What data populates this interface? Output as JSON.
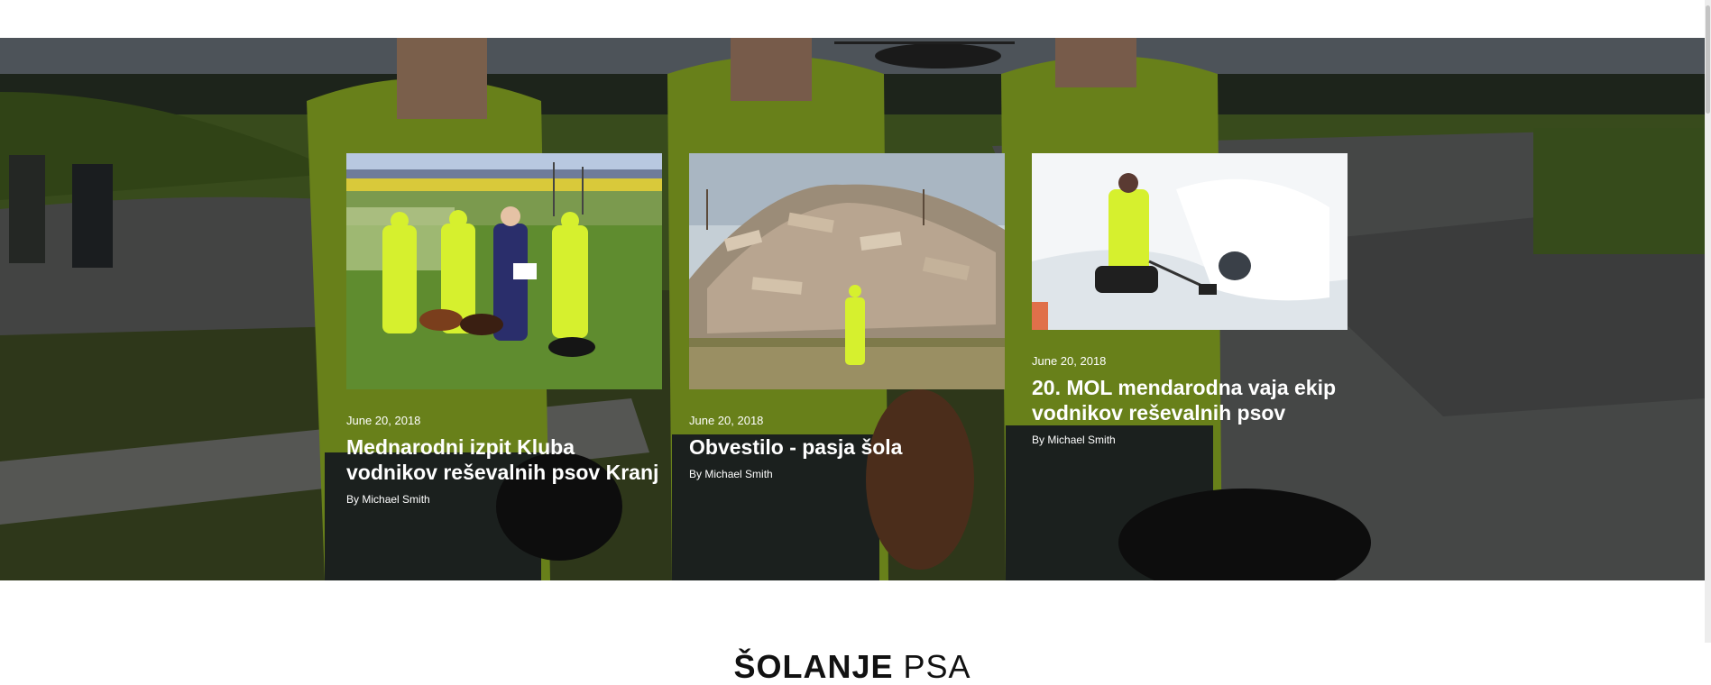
{
  "posts": [
    {
      "date": "June 20, 2018",
      "title": "Mednarodni izpit Kluba vodnikov reševalnih psov Kranj",
      "author_prefix": "By",
      "author": "Michael Smith",
      "image_desc": "team-photo-field"
    },
    {
      "date": "June 20, 2018",
      "title": "Obvestilo - pasja šola",
      "author_prefix": "By",
      "author": "Michael Smith",
      "image_desc": "rubble-pile"
    },
    {
      "date": "June 20, 2018",
      "title": "20. MOL mendarodna vaja ekip vodnikov reševalnih psov",
      "author_prefix": "By",
      "author": "Michael Smith",
      "image_desc": "snow-cave"
    }
  ],
  "section": {
    "heading_bold": "ŠOLANJE",
    "heading_light": "PSA"
  },
  "colors": {
    "hi_vis": "#c8f02a",
    "overlay": "rgba(0,0,0,0.38)",
    "text": "#ffffff"
  }
}
